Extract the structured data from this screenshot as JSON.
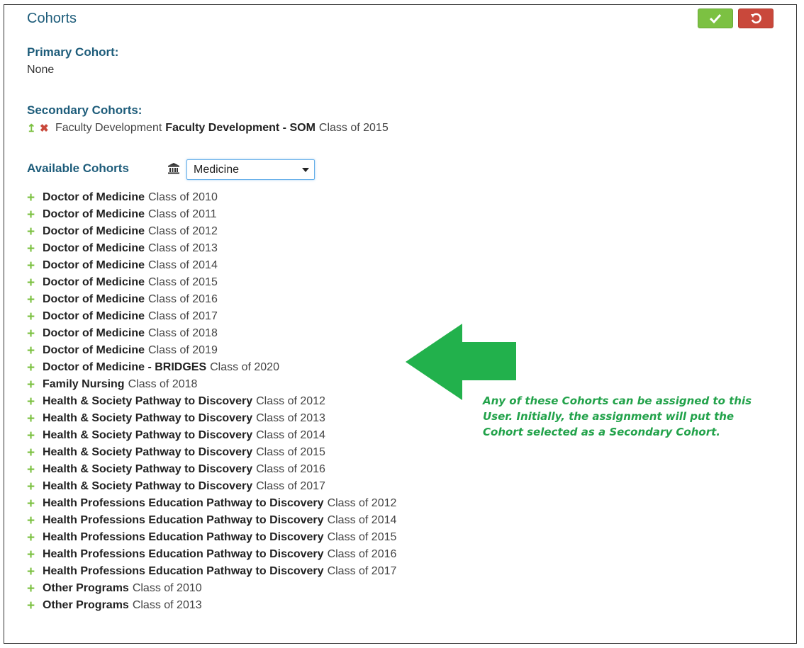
{
  "header": {
    "title": "Cohorts",
    "save_icon": "check-icon",
    "undo_icon": "undo-icon"
  },
  "primary": {
    "label": "Primary Cohort:",
    "value": "None"
  },
  "secondary": {
    "label": "Secondary Cohorts:",
    "items": [
      {
        "school": "Faculty Development",
        "program": "Faculty Development - SOM",
        "cls": "Class of 2015"
      }
    ]
  },
  "available": {
    "label": "Available Cohorts",
    "school_icon": "institution-icon",
    "school_select": "Medicine",
    "items": [
      {
        "program": "Doctor of Medicine",
        "cls": "Class of 2010"
      },
      {
        "program": "Doctor of Medicine",
        "cls": "Class of 2011"
      },
      {
        "program": "Doctor of Medicine",
        "cls": "Class of 2012"
      },
      {
        "program": "Doctor of Medicine",
        "cls": "Class of 2013"
      },
      {
        "program": "Doctor of Medicine",
        "cls": "Class of 2014"
      },
      {
        "program": "Doctor of Medicine",
        "cls": "Class of 2015"
      },
      {
        "program": "Doctor of Medicine",
        "cls": "Class of 2016"
      },
      {
        "program": "Doctor of Medicine",
        "cls": "Class of 2017"
      },
      {
        "program": "Doctor of Medicine",
        "cls": "Class of 2018"
      },
      {
        "program": "Doctor of Medicine",
        "cls": "Class of 2019"
      },
      {
        "program": "Doctor of Medicine - BRIDGES",
        "cls": "Class of 2020"
      },
      {
        "program": "Family Nursing",
        "cls": "Class of 2018"
      },
      {
        "program": "Health & Society Pathway to Discovery",
        "cls": "Class of 2012"
      },
      {
        "program": "Health & Society Pathway to Discovery",
        "cls": "Class of 2013"
      },
      {
        "program": "Health & Society Pathway to Discovery",
        "cls": "Class of 2014"
      },
      {
        "program": "Health & Society Pathway to Discovery",
        "cls": "Class of 2015"
      },
      {
        "program": "Health & Society Pathway to Discovery",
        "cls": "Class of 2016"
      },
      {
        "program": "Health & Society Pathway to Discovery",
        "cls": "Class of 2017"
      },
      {
        "program": "Health Professions Education Pathway to Discovery",
        "cls": "Class of 2012"
      },
      {
        "program": "Health Professions Education Pathway to Discovery",
        "cls": "Class of 2014"
      },
      {
        "program": "Health Professions Education Pathway to Discovery",
        "cls": "Class of 2015"
      },
      {
        "program": "Health Professions Education Pathway to Discovery",
        "cls": "Class of 2016"
      },
      {
        "program": "Health Professions Education Pathway to Discovery",
        "cls": "Class of 2017"
      },
      {
        "program": "Other Programs",
        "cls": "Class of 2010"
      },
      {
        "program": "Other Programs",
        "cls": "Class of 2013"
      }
    ]
  },
  "annotation": {
    "text": "Any of these Cohorts can be assigned to this User.  Initially, the assignment will put the Cohort selected as a Secondary Cohort.",
    "color": "#22b14c"
  },
  "colors": {
    "heading": "#1d5c7a",
    "save": "#7cc142",
    "undo": "#c9483b"
  }
}
